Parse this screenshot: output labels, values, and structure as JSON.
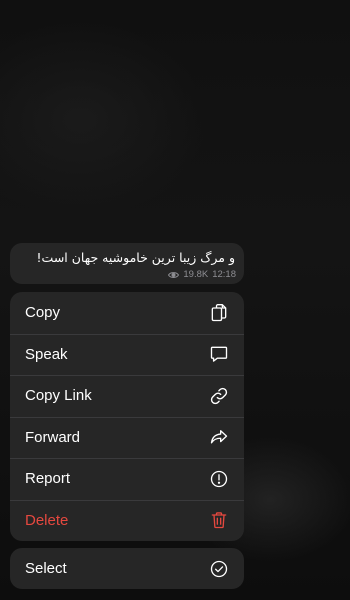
{
  "message": {
    "text": "و مرگ زیبا ترین خاموشیه جهان است!",
    "views": "19.8K",
    "time": "12:18"
  },
  "menu": {
    "items": [
      {
        "label": "Copy",
        "icon": "copy-icon",
        "destructive": false
      },
      {
        "label": "Speak",
        "icon": "speech-bubble-icon",
        "destructive": false
      },
      {
        "label": "Copy Link",
        "icon": "link-icon",
        "destructive": false
      },
      {
        "label": "Forward",
        "icon": "forward-arrow-icon",
        "destructive": false
      },
      {
        "label": "Report",
        "icon": "exclamation-circle-icon",
        "destructive": false
      },
      {
        "label": "Delete",
        "icon": "trash-icon",
        "destructive": true
      }
    ],
    "select": {
      "label": "Select",
      "icon": "checkmark-circle-icon"
    }
  },
  "colors": {
    "background": "#0b0b0b",
    "surface": "#262626",
    "separator": "#3a3a3c",
    "text": "#ffffff",
    "secondary_text": "#8e8e93",
    "destructive": "#e5483f"
  }
}
